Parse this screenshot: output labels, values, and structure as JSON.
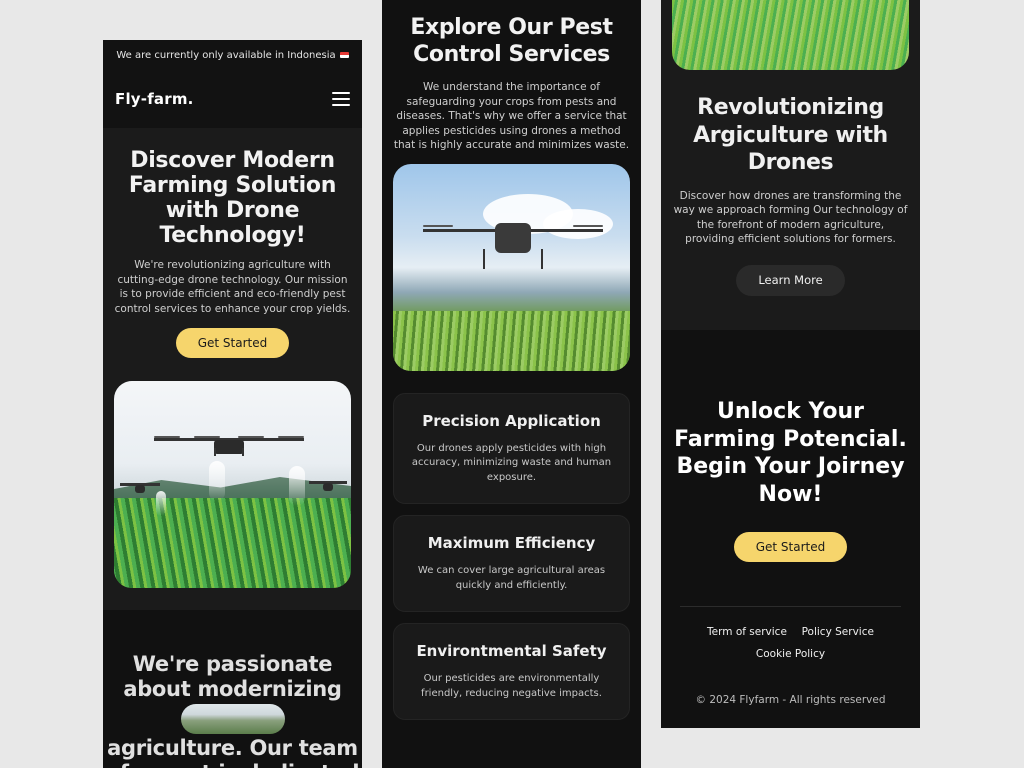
{
  "panel1": {
    "banner": "We are currently only available in Indonesia",
    "logo": "Fly-farm.",
    "hero": {
      "title": "Discover Modern Farming Solution with Drone Technology!",
      "text": "We're revolutionizing agriculture with cutting-edge drone technology. Our mission is to provide efficient and eco-friendly pest control services to enhance your crop yields.",
      "cta": "Get Started"
    },
    "passion": {
      "line1": "We're passionate about modernizing",
      "line2": "agriculture. Our team of expert is dedicated"
    }
  },
  "panel2": {
    "title": "Explore Our Pest Control Services",
    "intro": "We understand the importance of safeguarding your crops from pests and diseases. That's why we offer a service that applies pesticides using drones a method that is highly accurate and minimizes waste.",
    "cards": [
      {
        "title": "Precision Application",
        "text": "Our drones apply pesticides with high accuracy, minimizing waste and human exposure."
      },
      {
        "title": "Maximum Efficiency",
        "text": "We can cover large agricultural areas quickly and efficiently."
      },
      {
        "title": "Environtmental Safety",
        "text": "Our pesticides are environmentally friendly, reducing negative impacts."
      }
    ]
  },
  "panel3": {
    "revo": {
      "title": "Revolutionizing Argiculture with Drones",
      "text": "Discover how drones are transforming the way we approach forming Our technology of the forefront of modern agriculture, providing efficient solutions for formers.",
      "button": "Learn More"
    },
    "cta": {
      "title": "Unlock Your Farming Potencial. Begin Your Joirney Now!",
      "button": "Get Started"
    },
    "footer": {
      "terms": "Term of service",
      "policy": "Policy Service",
      "cookie": "Cookie Policy",
      "copyright": "© 2024 Flyfarm - All rights reserved"
    }
  },
  "colors": {
    "page_bg": "#e8e8e8",
    "panel_bg": "#111111",
    "section_bg": "#1b1b1b",
    "accent_yellow": "#f6d56c"
  },
  "icons": [
    "hamburger-menu-icon",
    "indonesia-flag-icon"
  ]
}
